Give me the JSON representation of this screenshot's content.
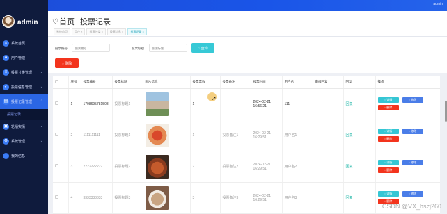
{
  "topbar": {
    "user": "admin"
  },
  "brand": {
    "name": "admin"
  },
  "sidebar": {
    "items": [
      {
        "label": "系统首页",
        "icon": "home-icon",
        "arrow": ""
      },
      {
        "label": "用户管理",
        "icon": "user-icon",
        "arrow": "⌄"
      },
      {
        "label": "投票分类管理",
        "icon": "category-icon",
        "arrow": "⌄"
      },
      {
        "label": "投票信息管理",
        "icon": "vote-icon",
        "arrow": "⌄"
      },
      {
        "label": "投票记录管理",
        "icon": "record-icon",
        "arrow": "⌃"
      }
    ],
    "submenu": "投票记录",
    "items_after": [
      {
        "label": "轮播实情",
        "icon": "carousel-icon",
        "arrow": "⌄"
      },
      {
        "label": "系统管理",
        "icon": "system-icon",
        "arrow": "⌄"
      },
      {
        "label": "我的信息",
        "icon": "info-icon",
        "arrow": "⌄"
      }
    ]
  },
  "page": {
    "title": "首页",
    "subtitle": "投票记录",
    "crumbs": [
      "系统首页",
      "用户 ×",
      "投票分类 ×",
      "投票信息 ×",
      "投票记录 ×"
    ]
  },
  "search": {
    "vote_no_label": "投票编号",
    "vote_no_placeholder": "投票编号",
    "vote_title_label": "投票标题",
    "vote_title_placeholder": "投票标题",
    "search_button": "◌ 查询",
    "delete_button": "◌ 删除"
  },
  "table": {
    "headers": [
      "",
      "序号",
      "投票编号",
      "投票标题",
      "图片信息",
      "投票票数",
      "投票备注",
      "投票时间",
      "用户名",
      "审核回复",
      "回复",
      "操作"
    ],
    "rows": [
      {
        "index": "1",
        "no": "1708695781508",
        "title": "投票标题1",
        "votes": "1",
        "note": "",
        "time": "2024-02-21 16:56:21",
        "user": "111",
        "reply": "",
        "status": "回复"
      },
      {
        "index": "2",
        "no": "1111111111",
        "title": "投票标题1",
        "votes": "1",
        "note": "投票备注1",
        "time": "2024-02-21 16:29:51",
        "user": "用户名1",
        "reply": "",
        "status": "回复"
      },
      {
        "index": "3",
        "no": "2222222222",
        "title": "投票标题2",
        "votes": "2",
        "note": "投票备注2",
        "time": "2024-02-21 16:29:51",
        "user": "用户名2",
        "reply": "",
        "status": "回复"
      },
      {
        "index": "4",
        "no": "3333333333",
        "title": "投票标题3",
        "votes": "3",
        "note": "投票备注3",
        "time": "2024-02-21 16:29:51",
        "user": "用户名3",
        "reply": "",
        "status": "回复"
      }
    ],
    "ops": {
      "detail": "◌ 详情",
      "edit": "◌ 修改",
      "delete": "◌ 删除"
    }
  },
  "watermark": "CSDN @VX_bszj260",
  "colors": {
    "sidebar": "#0f1b3d",
    "topbar": "#1d4dd8",
    "accent": "#37c9d6",
    "danger": "#f3341d",
    "edit": "#4a7de8"
  }
}
